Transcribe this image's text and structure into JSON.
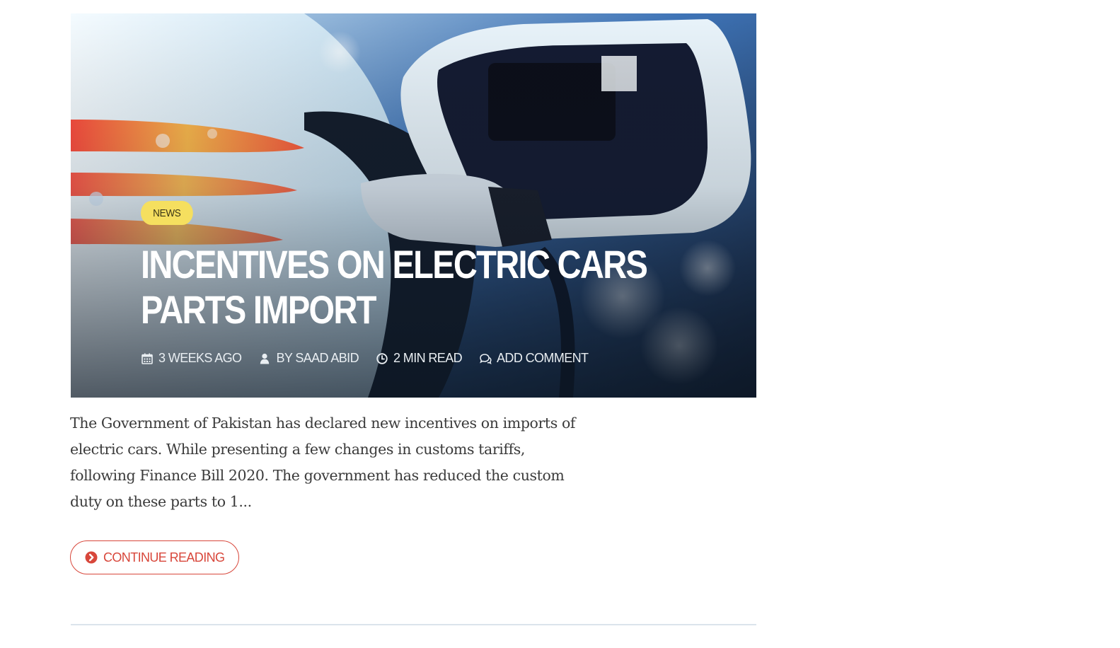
{
  "post": {
    "category": "NEWS",
    "title": "INCENTIVES ON ELECTRIC CARS PARTS IMPORT",
    "meta": {
      "date": "3 WEEKS AGO",
      "author": "BY SAAD ABID",
      "read_time": "2 MIN READ",
      "comments": "ADD COMMENT"
    },
    "excerpt": "The Government of Pakistan has declared new incentives on imports of electric cars. While presenting a few changes in customs tariffs, following Finance Bill 2020. The government has reduced the custom duty on these parts to 1...",
    "continue_label": "CONTINUE READING",
    "hero_image": "electric-car-charging-photo"
  },
  "colors": {
    "badge_bg": "#f5df5f",
    "accent": "#d8473b",
    "divider": "#dbe4ec",
    "body_text": "#3b3b3b"
  },
  "icons": {
    "date": "calendar-icon",
    "author": "user-icon",
    "read_time": "clock-icon",
    "comments": "comments-icon",
    "continue": "chevron-circle-right-icon"
  }
}
